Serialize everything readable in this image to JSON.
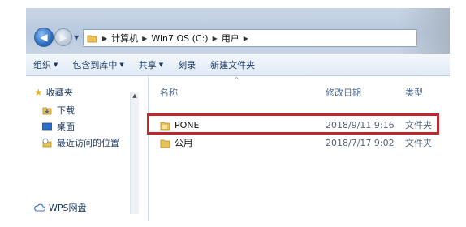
{
  "addressbar": {
    "crumbs": [
      "计算机",
      "Win7 OS (C:)",
      "用户"
    ]
  },
  "toolbar": {
    "organize": "组织",
    "include_in_library": "包含到库中",
    "share": "共享",
    "burn": "刻录",
    "new_folder": "新建文件夹"
  },
  "sidebar": {
    "favorites": "收藏夹",
    "items": [
      {
        "label": "下载",
        "icon": "download-folder-icon"
      },
      {
        "label": "桌面",
        "icon": "desktop-icon"
      },
      {
        "label": "最近访问的位置",
        "icon": "recent-places-icon"
      }
    ],
    "wps": "WPS网盘"
  },
  "columns": {
    "name": "名称",
    "modified": "修改日期",
    "type": "类型"
  },
  "files": [
    {
      "name": "PONE",
      "modified": "2018/9/11 9:16",
      "type": "文件夹"
    },
    {
      "name": "公用",
      "modified": "2018/7/17 9:02",
      "type": "文件夹"
    }
  ],
  "colors": {
    "highlight": "#c0272d",
    "accent": "#1e3a5f"
  }
}
